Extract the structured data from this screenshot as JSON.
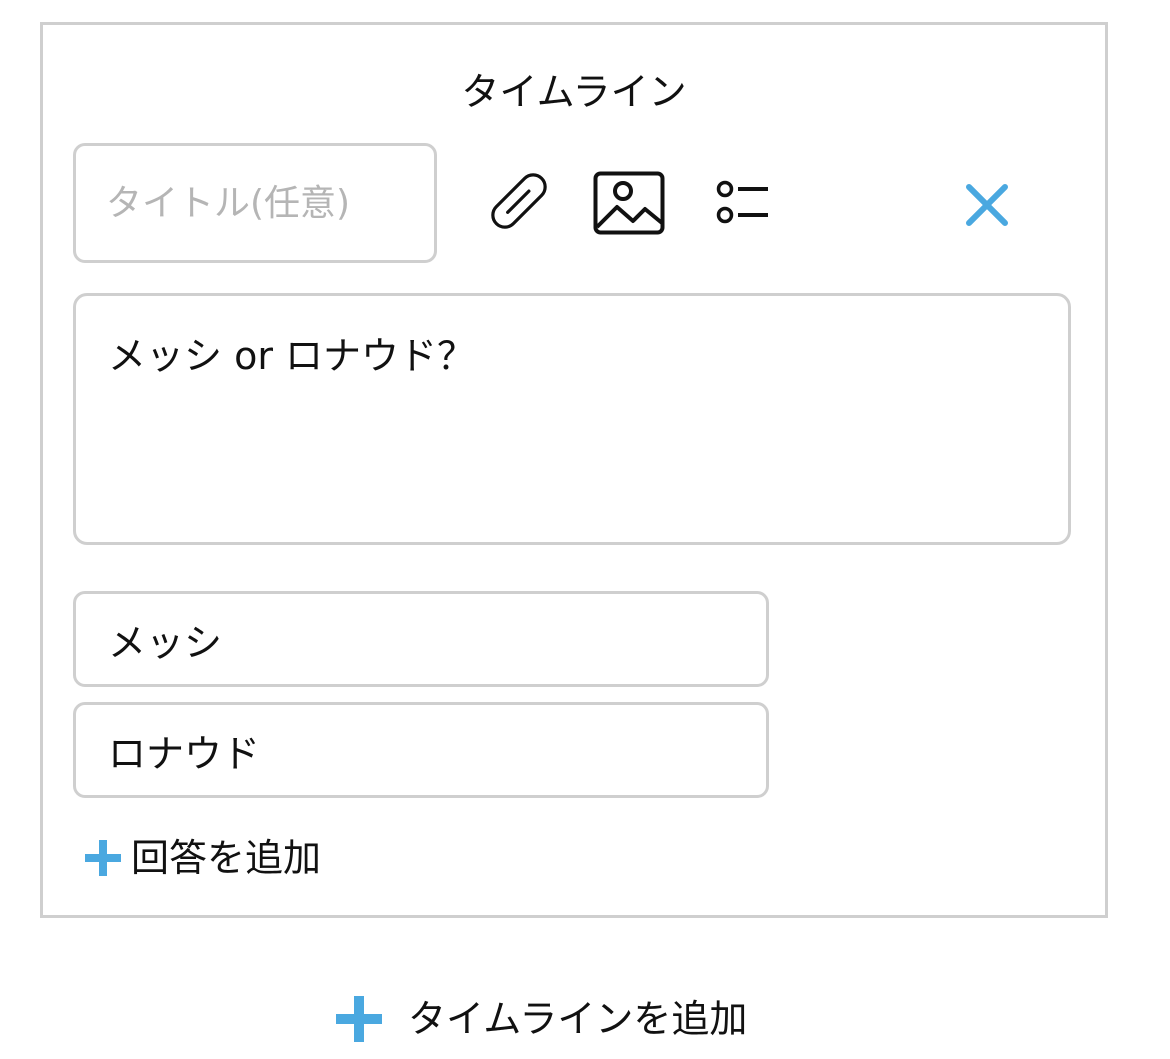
{
  "card": {
    "title": "タイムライン",
    "title_input": {
      "placeholder": "タイトル(任意)",
      "value": ""
    },
    "toolbar": {
      "link_icon": "paperclip-icon",
      "image_icon": "image-icon",
      "list_icon": "poll-list-icon",
      "close_icon": "close-icon"
    },
    "question": {
      "value": "メッシ or ロナウド？"
    },
    "answers": [
      {
        "value": "メッシ"
      },
      {
        "value": "ロナウド"
      }
    ],
    "add_answer_label": "回答を追加"
  },
  "add_timeline_label": "タイムラインを追加",
  "colors": {
    "accent": "#4aa8e0",
    "border": "#cfcfcf",
    "placeholder": "#b5b5b5",
    "text": "#111111"
  }
}
